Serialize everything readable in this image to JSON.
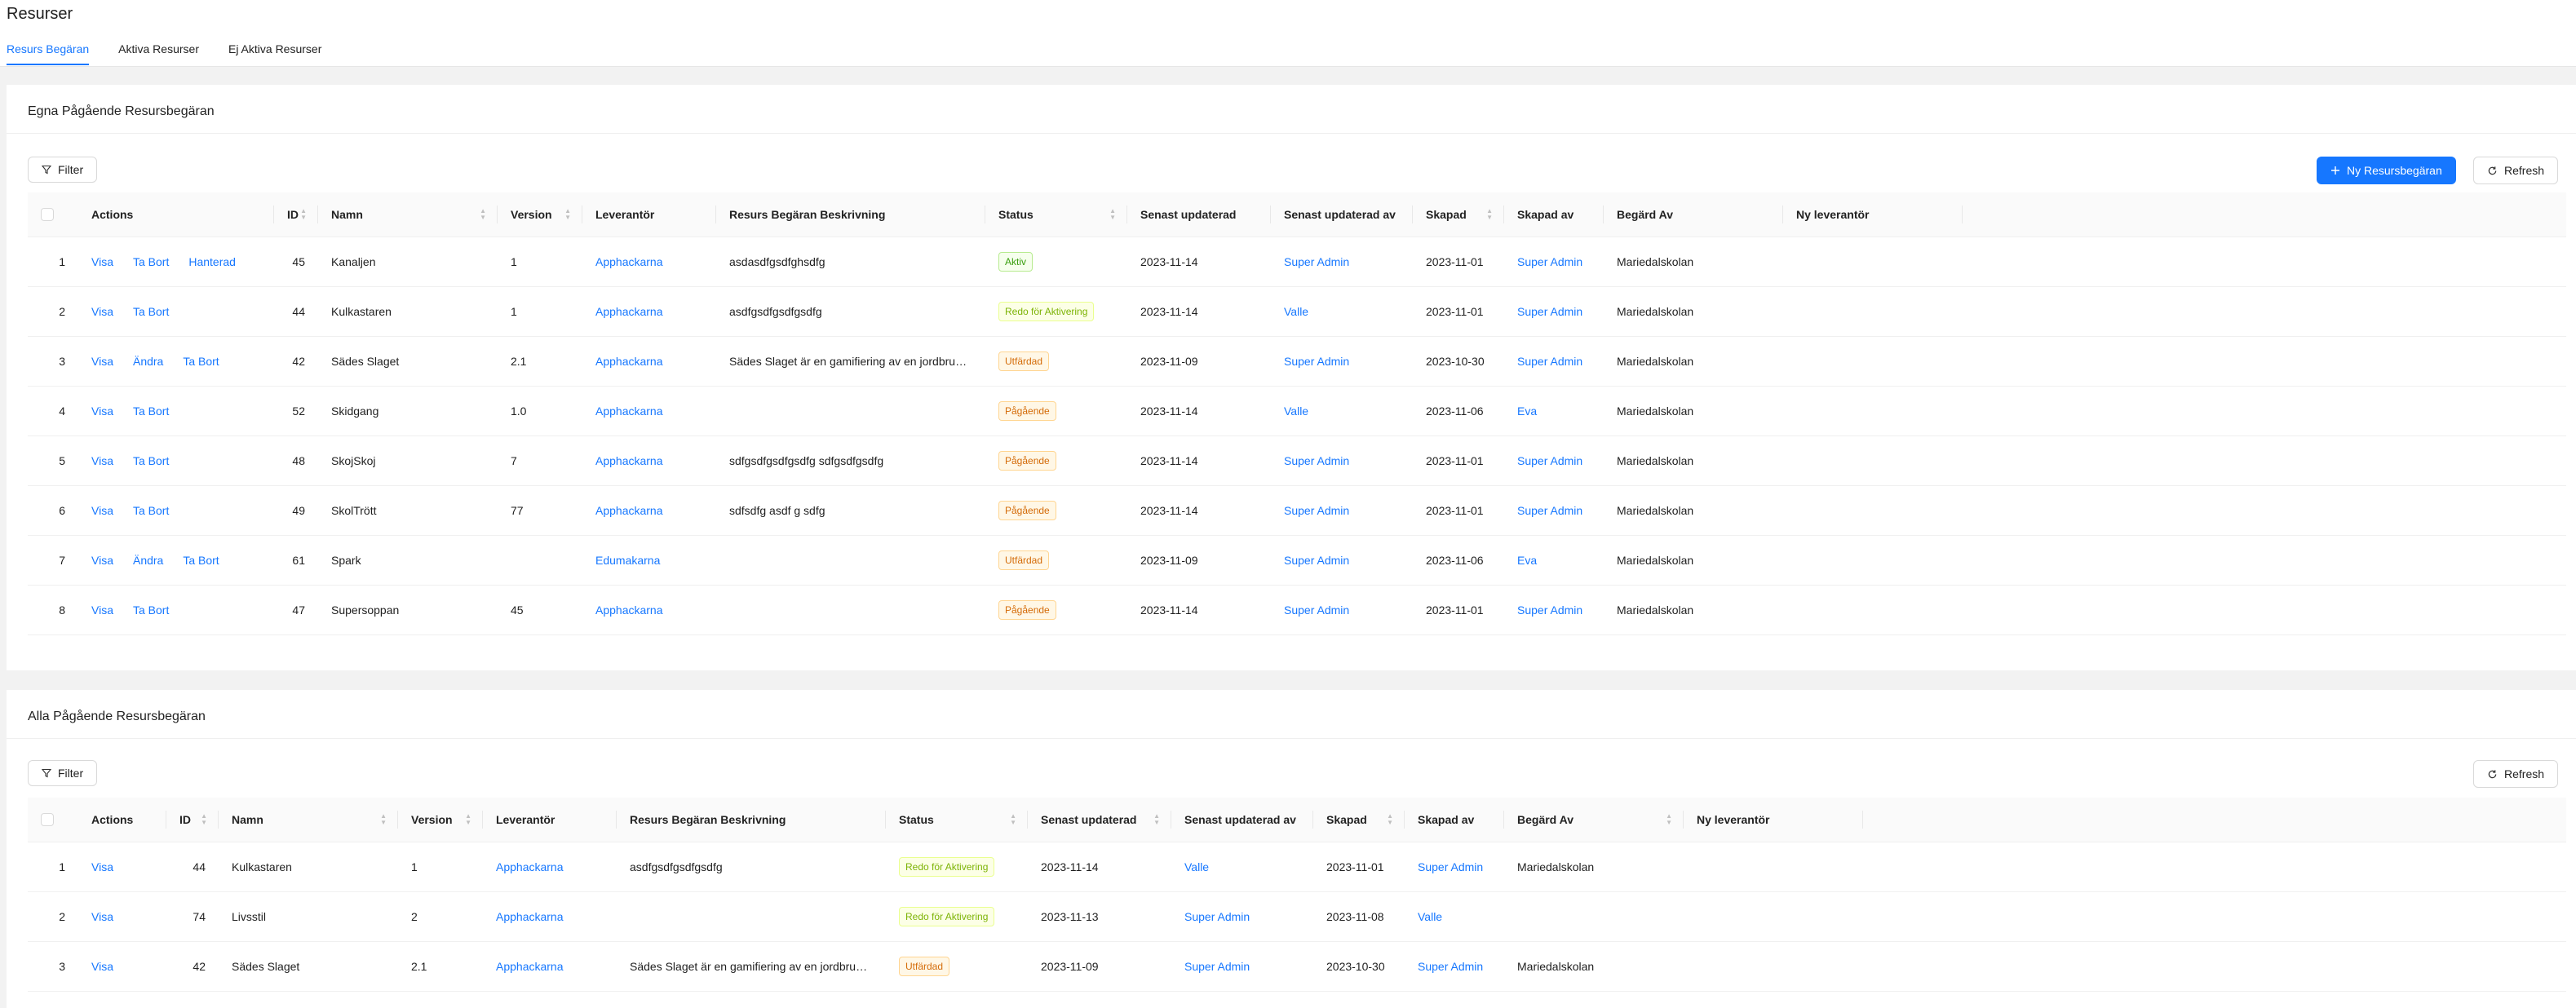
{
  "page": {
    "title": "Resurser"
  },
  "tabs": [
    {
      "label": "Resurs Begäran"
    },
    {
      "label": "Aktiva Resurser"
    },
    {
      "label": "Ej Aktiva Resurser"
    }
  ],
  "colors": {
    "primary": "#1677ff",
    "aktiv": "#389e0d",
    "redo": "#7cb305",
    "pagaende": "#d46b08"
  },
  "icons": {
    "filter": "filter-icon",
    "plus": "plus-icon",
    "refresh": "refresh-icon",
    "sort": "sort-icon"
  },
  "own": {
    "title": "Egna Pågående Resursbegäran",
    "filter_label": "Filter",
    "new_label": "Ny Resursbegäran",
    "refresh_label": "Refresh",
    "columns": [
      "Actions",
      "ID",
      "Namn",
      "Version",
      "Leverantör",
      "Resurs Begäran Beskrivning",
      "Status",
      "Senast updaterad",
      "Senast updaterad av",
      "Skapad",
      "Skapad av",
      "Begärd Av",
      "Ny leverantör"
    ],
    "rows": [
      {
        "idx": "1",
        "actions": [
          "Visa",
          "Ta Bort",
          "Hanterad"
        ],
        "id": "45",
        "namn": "Kanaljen",
        "version": "1",
        "leverantor": "Apphackarna",
        "beskrivning": "asdasdfgsdfghsdfg",
        "status": "Aktiv",
        "status_type": "green",
        "updated": "2023-11-14",
        "updated_by": "Super Admin",
        "created": "2023-11-01",
        "created_by": "Super Admin",
        "begard": "Mariedalskolan",
        "ny": ""
      },
      {
        "idx": "2",
        "actions": [
          "Visa",
          "Ta Bort"
        ],
        "id": "44",
        "namn": "Kulkastaren",
        "version": "1",
        "leverantor": "Apphackarna",
        "beskrivning": "asdfgsdfgsdfgsdfg",
        "status": "Redo för Aktivering",
        "status_type": "lime",
        "updated": "2023-11-14",
        "updated_by": "Valle",
        "created": "2023-11-01",
        "created_by": "Super Admin",
        "begard": "Mariedalskolan",
        "ny": ""
      },
      {
        "idx": "3",
        "actions": [
          "Visa",
          "Ändra",
          "Ta Bort"
        ],
        "id": "42",
        "namn": "Sädes Slaget",
        "version": "2.1",
        "leverantor": "Apphackarna",
        "beskrivning": "Sädes Slaget är en gamifiering av en jordbruks...",
        "status": "Utfärdad",
        "status_type": "orange",
        "updated": "2023-11-09",
        "updated_by": "Super Admin",
        "created": "2023-10-30",
        "created_by": "Super Admin",
        "begard": "Mariedalskolan",
        "ny": ""
      },
      {
        "idx": "4",
        "actions": [
          "Visa",
          "Ta Bort"
        ],
        "id": "52",
        "namn": "Skidgang",
        "version": "1.0",
        "leverantor": "Apphackarna",
        "beskrivning": "",
        "status": "Pågående",
        "status_type": "orange",
        "updated": "2023-11-14",
        "updated_by": "Valle",
        "created": "2023-11-06",
        "created_by": "Eva",
        "begard": "Mariedalskolan",
        "ny": ""
      },
      {
        "idx": "5",
        "actions": [
          "Visa",
          "Ta Bort"
        ],
        "id": "48",
        "namn": "SkojSkoj",
        "version": "7",
        "leverantor": "Apphackarna",
        "beskrivning": "sdfgsdfgsdfgsdfg sdfgsdfgsdfg",
        "status": "Pågående",
        "status_type": "orange",
        "updated": "2023-11-14",
        "updated_by": "Super Admin",
        "created": "2023-11-01",
        "created_by": "Super Admin",
        "begard": "Mariedalskolan",
        "ny": ""
      },
      {
        "idx": "6",
        "actions": [
          "Visa",
          "Ta Bort"
        ],
        "id": "49",
        "namn": "SkolTrött",
        "version": "77",
        "leverantor": "Apphackarna",
        "beskrivning": "sdfsdfg asdf g sdfg",
        "status": "Pågående",
        "status_type": "orange",
        "updated": "2023-11-14",
        "updated_by": "Super Admin",
        "created": "2023-11-01",
        "created_by": "Super Admin",
        "begard": "Mariedalskolan",
        "ny": ""
      },
      {
        "idx": "7",
        "actions": [
          "Visa",
          "Ändra",
          "Ta Bort"
        ],
        "id": "61",
        "namn": "Spark",
        "version": "",
        "leverantor": "Edumakarna",
        "beskrivning": "",
        "status": "Utfärdad",
        "status_type": "orange",
        "updated": "2023-11-09",
        "updated_by": "Super Admin",
        "created": "2023-11-06",
        "created_by": "Eva",
        "begard": "Mariedalskolan",
        "ny": ""
      },
      {
        "idx": "8",
        "actions": [
          "Visa",
          "Ta Bort"
        ],
        "id": "47",
        "namn": "Supersoppan",
        "version": "45",
        "leverantor": "Apphackarna",
        "beskrivning": "",
        "status": "Pågående",
        "status_type": "orange",
        "updated": "2023-11-14",
        "updated_by": "Super Admin",
        "created": "2023-11-01",
        "created_by": "Super Admin",
        "begard": "Mariedalskolan",
        "ny": ""
      }
    ]
  },
  "all": {
    "title": "Alla Pågående Resursbegäran",
    "filter_label": "Filter",
    "refresh_label": "Refresh",
    "columns": [
      "Actions",
      "ID",
      "Namn",
      "Version",
      "Leverantör",
      "Resurs Begäran Beskrivning",
      "Status",
      "Senast updaterad",
      "Senast updaterad av",
      "Skapad",
      "Skapad av",
      "Begärd Av",
      "Ny leverantör"
    ],
    "rows": [
      {
        "idx": "1",
        "actions": [
          "Visa"
        ],
        "id": "44",
        "namn": "Kulkastaren",
        "version": "1",
        "leverantor": "Apphackarna",
        "beskrivning": "asdfgsdfgsdfgsdfg",
        "status": "Redo för Aktivering",
        "status_type": "lime",
        "updated": "2023-11-14",
        "updated_by": "Valle",
        "created": "2023-11-01",
        "created_by": "Super Admin",
        "begard": "Mariedalskolan",
        "ny": ""
      },
      {
        "idx": "2",
        "actions": [
          "Visa"
        ],
        "id": "74",
        "namn": "Livsstil",
        "version": "2",
        "leverantor": "Apphackarna",
        "beskrivning": "",
        "status": "Redo för Aktivering",
        "status_type": "lime",
        "updated": "2023-11-13",
        "updated_by": "Super Admin",
        "created": "2023-11-08",
        "created_by": "Valle",
        "begard": "",
        "ny": ""
      },
      {
        "idx": "3",
        "actions": [
          "Visa"
        ],
        "id": "42",
        "namn": "Sädes Slaget",
        "version": "2.1",
        "leverantor": "Apphackarna",
        "beskrivning": "Sädes Slaget är en gamifiering av en jordbruks...",
        "status": "Utfärdad",
        "status_type": "orange",
        "updated": "2023-11-09",
        "updated_by": "Super Admin",
        "created": "2023-10-30",
        "created_by": "Super Admin",
        "begard": "Mariedalskolan",
        "ny": ""
      }
    ]
  }
}
